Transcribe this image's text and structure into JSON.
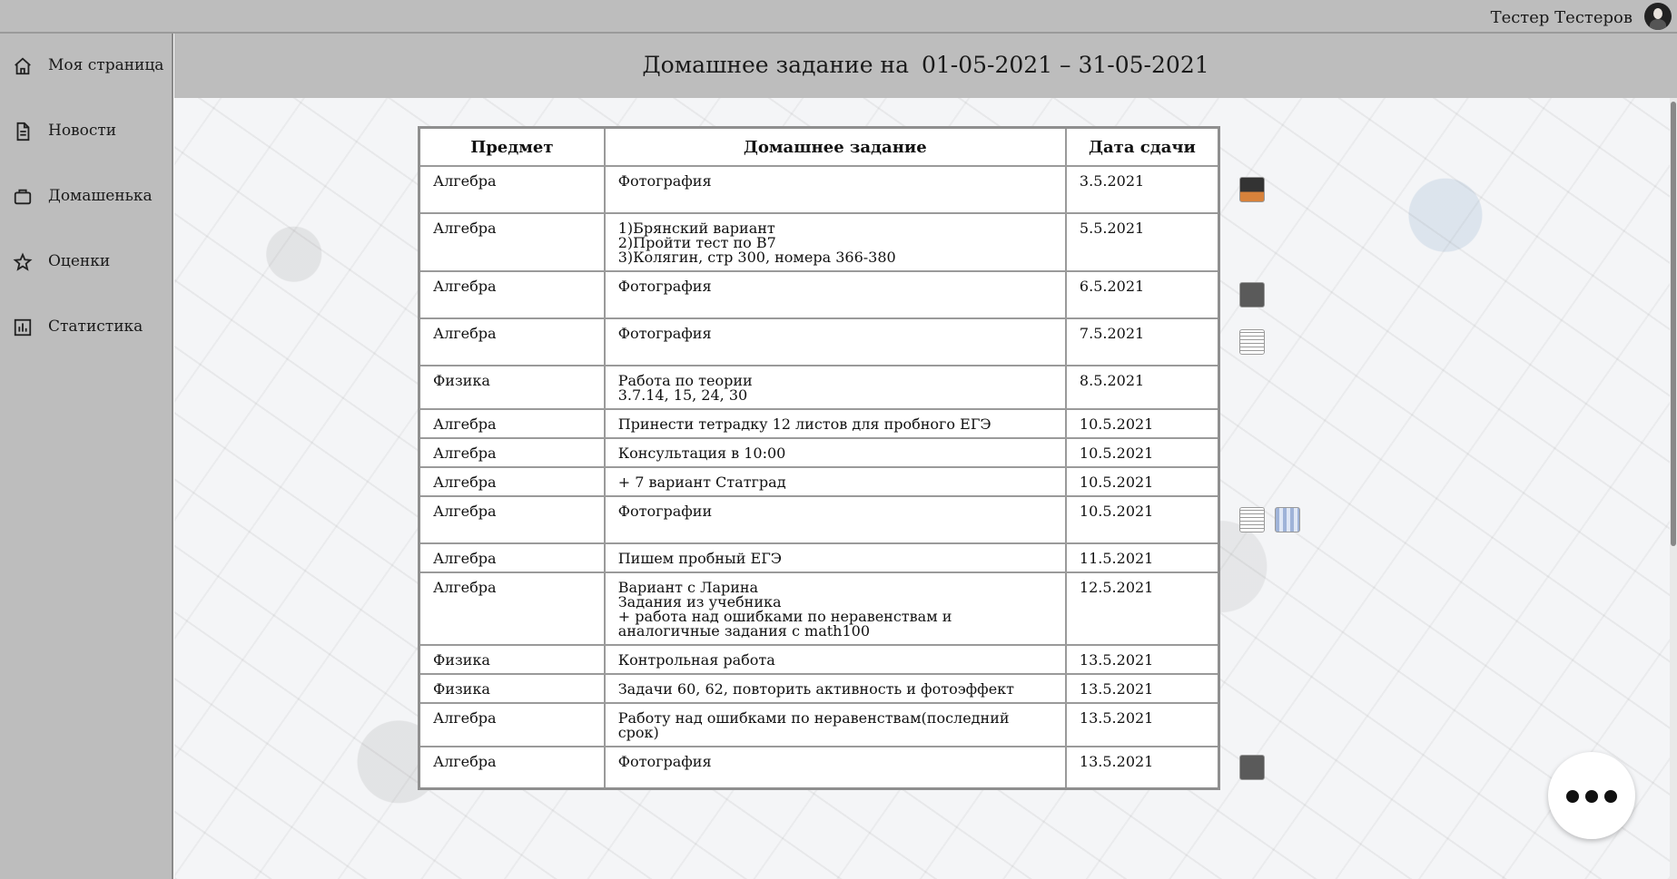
{
  "user": {
    "name": "Тестер Тестеров"
  },
  "sidebar": {
    "items": [
      {
        "label": "Моя страница",
        "icon": "home-icon"
      },
      {
        "label": "Новости",
        "icon": "document-icon"
      },
      {
        "label": "Домашенька",
        "icon": "briefcase-icon"
      },
      {
        "label": "Оценки",
        "icon": "star-icon"
      },
      {
        "label": "Статистика",
        "icon": "bar-chart-icon"
      }
    ]
  },
  "header": {
    "title_prefix": "Домашнее задание на",
    "date_range": "01-05-2021 – 31-05-2021"
  },
  "table": {
    "columns": [
      "Предмет",
      "Домашнее задание",
      "Дата сдачи"
    ],
    "rows": [
      {
        "subject": "Алгебра",
        "task": "Фотография",
        "date": "3.5.2021",
        "attachments": [
          "dark"
        ]
      },
      {
        "subject": "Алгебра",
        "task": "1)Брянский вариант\n2)Пройти тест по В7\n3)Колягин, стр 300, номера 366-380",
        "date": "5.5.2021",
        "attachments": []
      },
      {
        "subject": "Алгебра",
        "task": "Фотография",
        "date": "6.5.2021",
        "attachments": [
          "gray"
        ]
      },
      {
        "subject": "Алгебра",
        "task": "Фотография",
        "date": "7.5.2021",
        "attachments": [
          "paper"
        ]
      },
      {
        "subject": "Физика",
        "task": "Работа по теории\n3.7.14, 15, 24, 30",
        "date": "8.5.2021",
        "attachments": []
      },
      {
        "subject": "Алгебра",
        "task": "Принести тетрадку 12 листов для пробного ЕГЭ",
        "date": "10.5.2021",
        "attachments": []
      },
      {
        "subject": "Алгебра",
        "task": "Консультация в 10:00",
        "date": "10.5.2021",
        "attachments": []
      },
      {
        "subject": "Алгебра",
        "task": "+ 7 вариант Статград",
        "date": "10.5.2021",
        "attachments": []
      },
      {
        "subject": "Алгебра",
        "task": "Фотографии",
        "date": "10.5.2021",
        "attachments": [
          "paper",
          "blue"
        ]
      },
      {
        "subject": "Алгебра",
        "task": "Пишем пробный ЕГЭ",
        "date": "11.5.2021",
        "attachments": []
      },
      {
        "subject": "Алгебра",
        "task": "Вариант с Ларина\nЗадания из учебника\n+ работа над ошибками по неравенствам и\nаналогичные задания с math100",
        "date": "12.5.2021",
        "attachments": []
      },
      {
        "subject": "Физика",
        "task": "Контрольная работа",
        "date": "13.5.2021",
        "attachments": []
      },
      {
        "subject": "Физика",
        "task": "Задачи 60, 62, повторить активность и фотоэффект",
        "date": "13.5.2021",
        "attachments": []
      },
      {
        "subject": "Алгебра",
        "task": "Работу над ошибками по неравенствам(последний\nсрок)",
        "date": "13.5.2021",
        "attachments": []
      },
      {
        "subject": "Алгебра",
        "task": "Фотография",
        "date": "13.5.2021",
        "attachments": [
          "gray"
        ]
      }
    ]
  },
  "fab": {
    "icon": "more-dots-icon"
  },
  "colors": {
    "chrome": "#bdbdbd",
    "table_border": "#9a9a9a"
  }
}
